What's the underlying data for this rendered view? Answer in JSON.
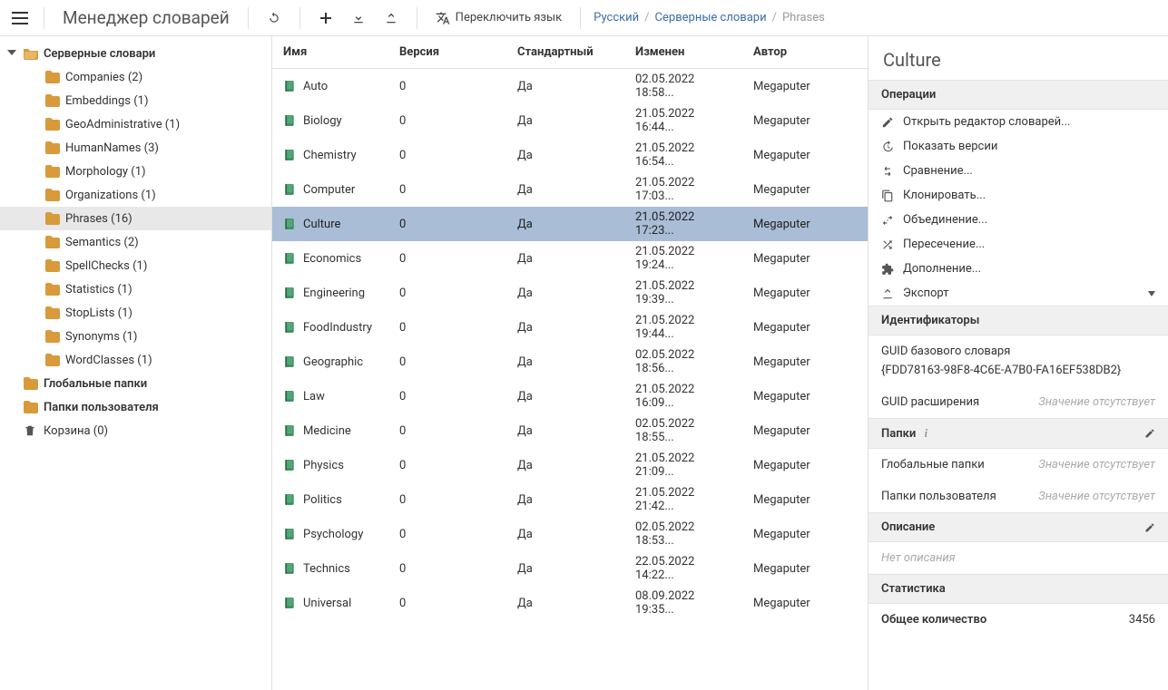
{
  "topbar": {
    "title": "Менеджер словарей",
    "lang_switch": "Переключить язык",
    "crumbs": [
      "Русский",
      "Серверные словари",
      "Phrases"
    ]
  },
  "sidebar": {
    "root": "Серверные словари",
    "folders": [
      {
        "label": "Companies (2)"
      },
      {
        "label": "Embeddings (1)"
      },
      {
        "label": "GeoAdministrative (1)"
      },
      {
        "label": "HumanNames (3)"
      },
      {
        "label": "Morphology (1)"
      },
      {
        "label": "Organizations (1)"
      },
      {
        "label": "Phrases (16)",
        "selected": true
      },
      {
        "label": "Semantics (2)"
      },
      {
        "label": "SpellChecks (1)"
      },
      {
        "label": "Statistics (1)"
      },
      {
        "label": "StopLists (1)"
      },
      {
        "label": "Synonyms (1)"
      },
      {
        "label": "WordClasses (1)"
      }
    ],
    "global_folders": "Глобальные папки",
    "user_folders": "Папки пользователя",
    "trash": "Корзина (0)"
  },
  "table": {
    "headers": {
      "name": "Имя",
      "version": "Версия",
      "standard": "Стандартный",
      "modified": "Изменен",
      "author": "Автор"
    },
    "rows": [
      {
        "name": "Auto",
        "version": "0",
        "standard": "Да",
        "modified": "02.05.2022 18:58...",
        "author": "Megaputer"
      },
      {
        "name": "Biology",
        "version": "0",
        "standard": "Да",
        "modified": "21.05.2022 16:44...",
        "author": "Megaputer"
      },
      {
        "name": "Chemistry",
        "version": "0",
        "standard": "Да",
        "modified": "21.05.2022 16:54...",
        "author": "Megaputer"
      },
      {
        "name": "Computer",
        "version": "0",
        "standard": "Да",
        "modified": "21.05.2022 17:03...",
        "author": "Megaputer"
      },
      {
        "name": "Culture",
        "version": "0",
        "standard": "Да",
        "modified": "21.05.2022 17:23...",
        "author": "Megaputer",
        "selected": true
      },
      {
        "name": "Economics",
        "version": "0",
        "standard": "Да",
        "modified": "21.05.2022 19:24...",
        "author": "Megaputer"
      },
      {
        "name": "Engineering",
        "version": "0",
        "standard": "Да",
        "modified": "21.05.2022 19:39...",
        "author": "Megaputer"
      },
      {
        "name": "FoodIndustry",
        "version": "0",
        "standard": "Да",
        "modified": "21.05.2022 19:44...",
        "author": "Megaputer"
      },
      {
        "name": "Geographic",
        "version": "0",
        "standard": "Да",
        "modified": "02.05.2022 18:56...",
        "author": "Megaputer"
      },
      {
        "name": "Law",
        "version": "0",
        "standard": "Да",
        "modified": "21.05.2022 16:09...",
        "author": "Megaputer"
      },
      {
        "name": "Medicine",
        "version": "0",
        "standard": "Да",
        "modified": "02.05.2022 18:55...",
        "author": "Megaputer"
      },
      {
        "name": "Physics",
        "version": "0",
        "standard": "Да",
        "modified": "21.05.2022 21:09...",
        "author": "Megaputer"
      },
      {
        "name": "Politics",
        "version": "0",
        "standard": "Да",
        "modified": "21.05.2022 21:42...",
        "author": "Megaputer"
      },
      {
        "name": "Psychology",
        "version": "0",
        "standard": "Да",
        "modified": "02.05.2022 18:53...",
        "author": "Megaputer"
      },
      {
        "name": "Technics",
        "version": "0",
        "standard": "Да",
        "modified": "22.05.2022 14:22...",
        "author": "Megaputer"
      },
      {
        "name": "Universal",
        "version": "0",
        "standard": "Да",
        "modified": "08.09.2022 19:35...",
        "author": "Megaputer"
      }
    ]
  },
  "detail": {
    "title": "Culture",
    "sections": {
      "operations": "Операции",
      "identifiers": "Идентификаторы",
      "folders": "Папки",
      "description": "Описание",
      "stats": "Статистика"
    },
    "ops": {
      "open_editor": "Открыть редактор словарей...",
      "show_versions": "Показать версии",
      "compare": "Сравнение...",
      "clone": "Клонировать...",
      "union": "Объединение...",
      "intersect": "Пересечение...",
      "append": "Дополнение...",
      "export": "Экспорт"
    },
    "ids": {
      "base_label": "GUID базового словаря",
      "base_value": "{FDD78163-98F8-4C6E-A7B0-FA16EF538DB2}",
      "ext_label": "GUID расширения",
      "missing": "Значение отсутствует"
    },
    "folders_kv": {
      "global": "Глобальные папки",
      "user": "Папки пользователя"
    },
    "desc_empty": "Нет описания",
    "stats_kv": {
      "total_label": "Общее количество",
      "total_value": "3456"
    }
  }
}
